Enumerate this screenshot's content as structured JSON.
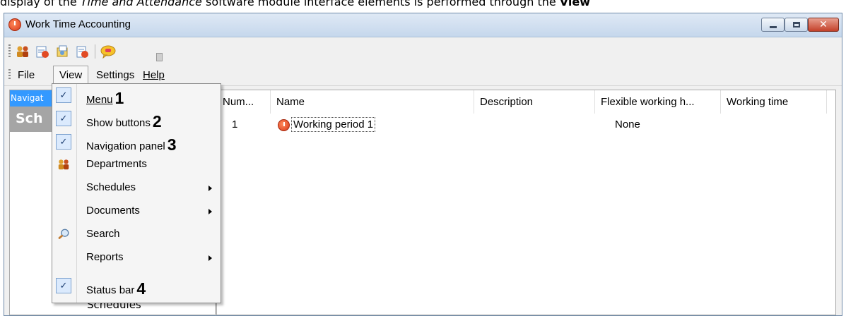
{
  "caption": {
    "pre": "display of the ",
    "italic": "Time and Attendance",
    "mid": " software module interface elements is performed through the ",
    "bold": "View"
  },
  "window": {
    "title": "Work Time Accounting",
    "controls": {
      "minimize": "minimize",
      "maximize": "maximize",
      "close": "✕"
    }
  },
  "toolbar": {
    "icons": [
      "departments-icon",
      "schedules-icon",
      "documents-icon",
      "reports-icon",
      "help-icon"
    ]
  },
  "menubar": {
    "items": [
      "File",
      "View",
      "Settings",
      "Help"
    ]
  },
  "nav_panel": {
    "header": "Navigat",
    "section": "Sch",
    "bottom_item": "Schedules"
  },
  "table": {
    "columns": [
      "Num...",
      "Name",
      "Description",
      "Flexible working h...",
      "Working time"
    ],
    "rows": [
      {
        "num": "1",
        "name": "Working period 1",
        "description": "",
        "flexible": "None",
        "working_time": ""
      }
    ]
  },
  "view_menu": {
    "items": [
      {
        "label": "Menu",
        "marker": "1",
        "checked": true
      },
      {
        "label": "Show buttons",
        "marker": "2",
        "checked": true
      },
      {
        "label": "Navigation panel",
        "marker": "3",
        "checked": true
      },
      {
        "label": "Departments",
        "icon": "departments-icon"
      },
      {
        "label": "Schedules",
        "submenu": true
      },
      {
        "label": "Documents",
        "submenu": true
      },
      {
        "label": "Search",
        "icon": "search-icon"
      },
      {
        "label": "Reports",
        "submenu": true
      },
      {
        "label": "Status bar",
        "marker": "4",
        "checked": true
      }
    ],
    "check_glyph": "✓"
  }
}
